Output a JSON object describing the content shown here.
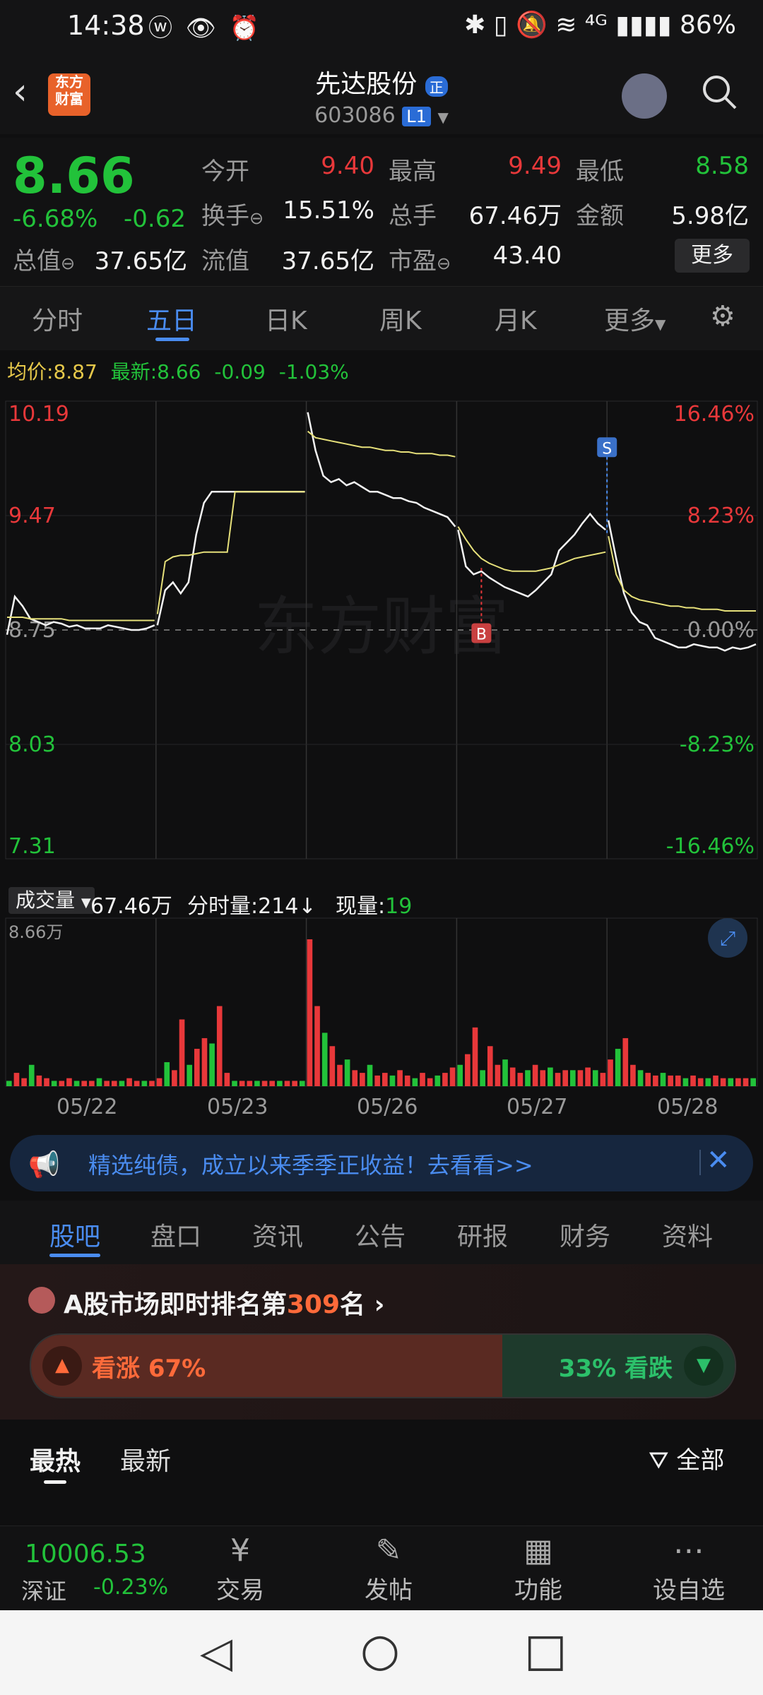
{
  "status_bar": {
    "time": "14:38",
    "icons": "ⓦ 👁 ⏰",
    "right": "✱ ▯ 🔕 ≋ ⁴ᴳ ▮▮▮▮  86%"
  },
  "header": {
    "back_icon": "‹",
    "logo_text": "东方\n财富",
    "title": "先达股份",
    "title_badge": "正",
    "code": "603086",
    "level": "L1"
  },
  "quote": {
    "price": "8.66",
    "change_pct": "-6.68%",
    "change_abs": "-0.62",
    "row1": [
      {
        "label": "今开",
        "value": "9.40",
        "color": "red"
      },
      {
        "label": "最高",
        "value": "9.49",
        "color": "red"
      },
      {
        "label": "最低",
        "value": "8.58",
        "color": "green"
      }
    ],
    "row2": [
      {
        "label": "换手",
        "value": "15.51%"
      },
      {
        "label": "总手",
        "value": "67.46万"
      },
      {
        "label": "金额",
        "value": "5.98亿"
      }
    ],
    "row3": [
      {
        "label": "总值",
        "value": "37.65亿"
      },
      {
        "label": "流值",
        "value": "37.65亿"
      },
      {
        "label": "市盈",
        "value": "43.40"
      }
    ],
    "more_button": "更多"
  },
  "chart_tabs": [
    "分时",
    "五日",
    "日K",
    "周K",
    "月K",
    "更多"
  ],
  "chart_tabs_active": 1,
  "info_line": {
    "avg_label": "均价:",
    "avg_value": "8.87",
    "latest_label": "最新:",
    "latest_value": "8.66",
    "chg": "-0.09",
    "chg_pct": "-1.03%"
  },
  "chart_data": {
    "type": "line",
    "title": "",
    "y_left_ticks": [
      "10.19",
      "9.47",
      "8.75",
      "8.03",
      "7.31"
    ],
    "y_right_ticks": [
      "16.46%",
      "8.23%",
      "0.00%",
      "-8.23%",
      "-16.46%"
    ],
    "ylim": [
      7.31,
      10.19
    ],
    "x_labels": [
      "05/22",
      "05/23",
      "05/26",
      "05/27",
      "05/28"
    ],
    "watermark": "东方财富",
    "markers": [
      {
        "label": "B",
        "day": 3
      },
      {
        "label": "S",
        "day": 4
      }
    ],
    "series": [
      {
        "name": "price",
        "color": "#f2f2f2",
        "values": [
          8.72,
          8.96,
          8.9,
          8.82,
          8.8,
          8.78,
          8.8,
          8.79,
          8.77,
          8.78,
          8.76,
          8.76,
          8.76,
          8.78,
          8.77,
          8.76,
          8.75,
          8.75,
          8.76,
          8.78,
          8.78,
          9.0,
          9.05,
          8.98,
          9.05,
          9.35,
          9.55,
          9.62,
          9.62,
          9.62,
          9.62,
          9.62,
          9.62,
          9.62,
          9.62,
          9.62,
          9.62,
          9.62,
          9.62,
          9.62,
          10.12,
          9.88,
          9.72,
          9.68,
          9.7,
          9.66,
          9.68,
          9.65,
          9.62,
          9.62,
          9.6,
          9.58,
          9.58,
          9.56,
          9.55,
          9.52,
          9.5,
          9.48,
          9.46,
          9.4,
          9.38,
          9.15,
          9.1,
          9.12,
          9.08,
          9.05,
          9.02,
          9.0,
          8.98,
          8.96,
          9.0,
          9.05,
          9.1,
          9.25,
          9.3,
          9.35,
          9.42,
          9.48,
          9.42,
          9.38,
          9.44,
          9.2,
          8.98,
          8.86,
          8.8,
          8.78,
          8.7,
          8.68,
          8.66,
          8.64,
          8.64,
          8.66,
          8.65,
          8.64,
          8.64,
          8.62,
          8.64,
          8.63,
          8.64,
          8.66
        ]
      },
      {
        "name": "avg",
        "color": "#e6e07a",
        "values": [
          8.83,
          8.83,
          8.83,
          8.82,
          8.82,
          8.82,
          8.82,
          8.82,
          8.81,
          8.81,
          8.81,
          8.81,
          8.81,
          8.81,
          8.81,
          8.81,
          8.81,
          8.81,
          8.81,
          8.81,
          8.85,
          9.18,
          9.21,
          9.22,
          9.22,
          9.23,
          9.24,
          9.24,
          9.24,
          9.24,
          9.62,
          9.62,
          9.62,
          9.62,
          9.62,
          9.62,
          9.62,
          9.62,
          9.62,
          9.62,
          10.0,
          9.96,
          9.95,
          9.94,
          9.93,
          9.92,
          9.91,
          9.9,
          9.9,
          9.89,
          9.88,
          9.88,
          9.87,
          9.87,
          9.86,
          9.86,
          9.86,
          9.85,
          9.85,
          9.84,
          9.4,
          9.32,
          9.25,
          9.2,
          9.17,
          9.15,
          9.13,
          9.12,
          9.12,
          9.12,
          9.12,
          9.13,
          9.14,
          9.16,
          9.18,
          9.2,
          9.21,
          9.22,
          9.23,
          9.24,
          9.34,
          9.1,
          9.0,
          8.96,
          8.94,
          8.93,
          8.92,
          8.91,
          8.9,
          8.9,
          8.89,
          8.89,
          8.88,
          8.88,
          8.88,
          8.87,
          8.87,
          8.87,
          8.87,
          8.87
        ]
      }
    ]
  },
  "volume": {
    "selector": "成交量",
    "total": "67.46万",
    "tick_label": "分时量:",
    "tick_value": "214↓",
    "now_label": "现量:",
    "now_value": "19",
    "max_label": "8.66万",
    "bars": [
      2,
      5,
      3,
      8,
      4,
      3,
      2,
      2,
      3,
      2,
      2,
      2,
      3,
      2,
      2,
      2,
      3,
      2,
      2,
      2,
      3,
      9,
      6,
      25,
      8,
      14,
      18,
      16,
      30,
      5,
      2,
      2,
      2,
      2,
      2,
      2,
      2,
      2,
      2,
      2,
      55,
      30,
      20,
      15,
      8,
      10,
      6,
      5,
      8,
      4,
      5,
      4,
      6,
      4,
      3,
      5,
      3,
      4,
      5,
      7,
      8,
      12,
      22,
      6,
      15,
      8,
      10,
      7,
      5,
      6,
      8,
      6,
      7,
      5,
      6,
      6,
      6,
      7,
      6,
      5,
      10,
      14,
      18,
      8,
      6,
      5,
      4,
      5,
      4,
      4,
      3,
      4,
      3,
      3,
      4,
      3,
      3,
      3,
      3,
      3
    ]
  },
  "ad": {
    "icon": "📢",
    "text": "精选纯债，成立以来季季正收益！去看看>>",
    "close": "✕"
  },
  "info_tabs": [
    "股吧",
    "盘口",
    "资讯",
    "公告",
    "研报",
    "财务",
    "资料"
  ],
  "ranking": {
    "prefix": "A股市场即时排名第",
    "rank": "309",
    "suffix": "名 ›"
  },
  "sentiment": {
    "bull_label": "看涨 67%",
    "bear_label": "33% 看跌",
    "bull_fraction": 0.67
  },
  "feed_tabs": {
    "hot": "最热",
    "latest": "最新",
    "filter": "全部"
  },
  "bottom_nav": {
    "index_value": "10006.53",
    "index_name": "深证",
    "index_change": "-0.23%",
    "items": [
      {
        "label": "交易",
        "icon": "¥"
      },
      {
        "label": "发帖",
        "icon": "✎"
      },
      {
        "label": "功能",
        "icon": "▦"
      },
      {
        "label": "设自选",
        "icon": "⋯"
      }
    ]
  },
  "system_nav": {
    "back": "◁",
    "home": "○",
    "recent": "□"
  }
}
